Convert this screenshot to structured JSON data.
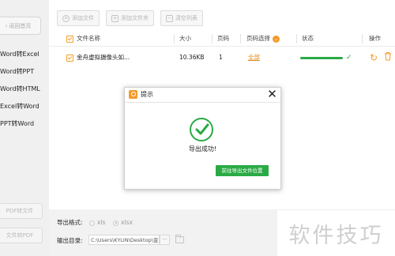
{
  "sidebar": {
    "back_label": "返回首页",
    "items": [
      {
        "label": "Word转Excel"
      },
      {
        "label": "Word转PPT"
      },
      {
        "label": "Word转HTML"
      },
      {
        "label": "Excel转Word"
      },
      {
        "label": "PPT转Word"
      }
    ],
    "bottom_buttons": [
      {
        "label": "PDF转文件"
      },
      {
        "label": "文件转PDF"
      }
    ]
  },
  "toolbar": {
    "add_file": "添加文件",
    "add_folder": "添加文件夹",
    "clear_list": "清空列表"
  },
  "table": {
    "headers": {
      "name": "文件名称",
      "size": "大小",
      "pages": "页码",
      "page_select": "页码选择",
      "status": "状态",
      "actions": "操作"
    },
    "rows": [
      {
        "name": "金舟虚拟摄像头如...",
        "size": "10.36KB",
        "pages": "1",
        "page_select": "全部",
        "progress": 1.0
      }
    ]
  },
  "footer": {
    "format_label": "导出格式:",
    "formats": [
      "xls",
      "xlsx"
    ],
    "selected_format": "xlsx",
    "dir_label": "输出目录:",
    "dir_value": "C:\\Users\\KYLIN\\Desktop\\金",
    "more": "···"
  },
  "dialog": {
    "title": "提示",
    "close": "✕",
    "message": "导出成功!",
    "button": "前往导出文件位置"
  },
  "watermark": "软件技巧",
  "colors": {
    "success": "#2aaa45",
    "accent": "#f39b2b",
    "page_link": "#e08a1e"
  },
  "icons": {
    "add_file": "plus-circle-icon",
    "add_folder": "folder-add-icon",
    "clear_list": "trash-icon",
    "refresh": "refresh-icon",
    "delete": "trash-icon",
    "success": "check-circle-icon",
    "close": "close-icon",
    "folder": "folder-icon"
  }
}
